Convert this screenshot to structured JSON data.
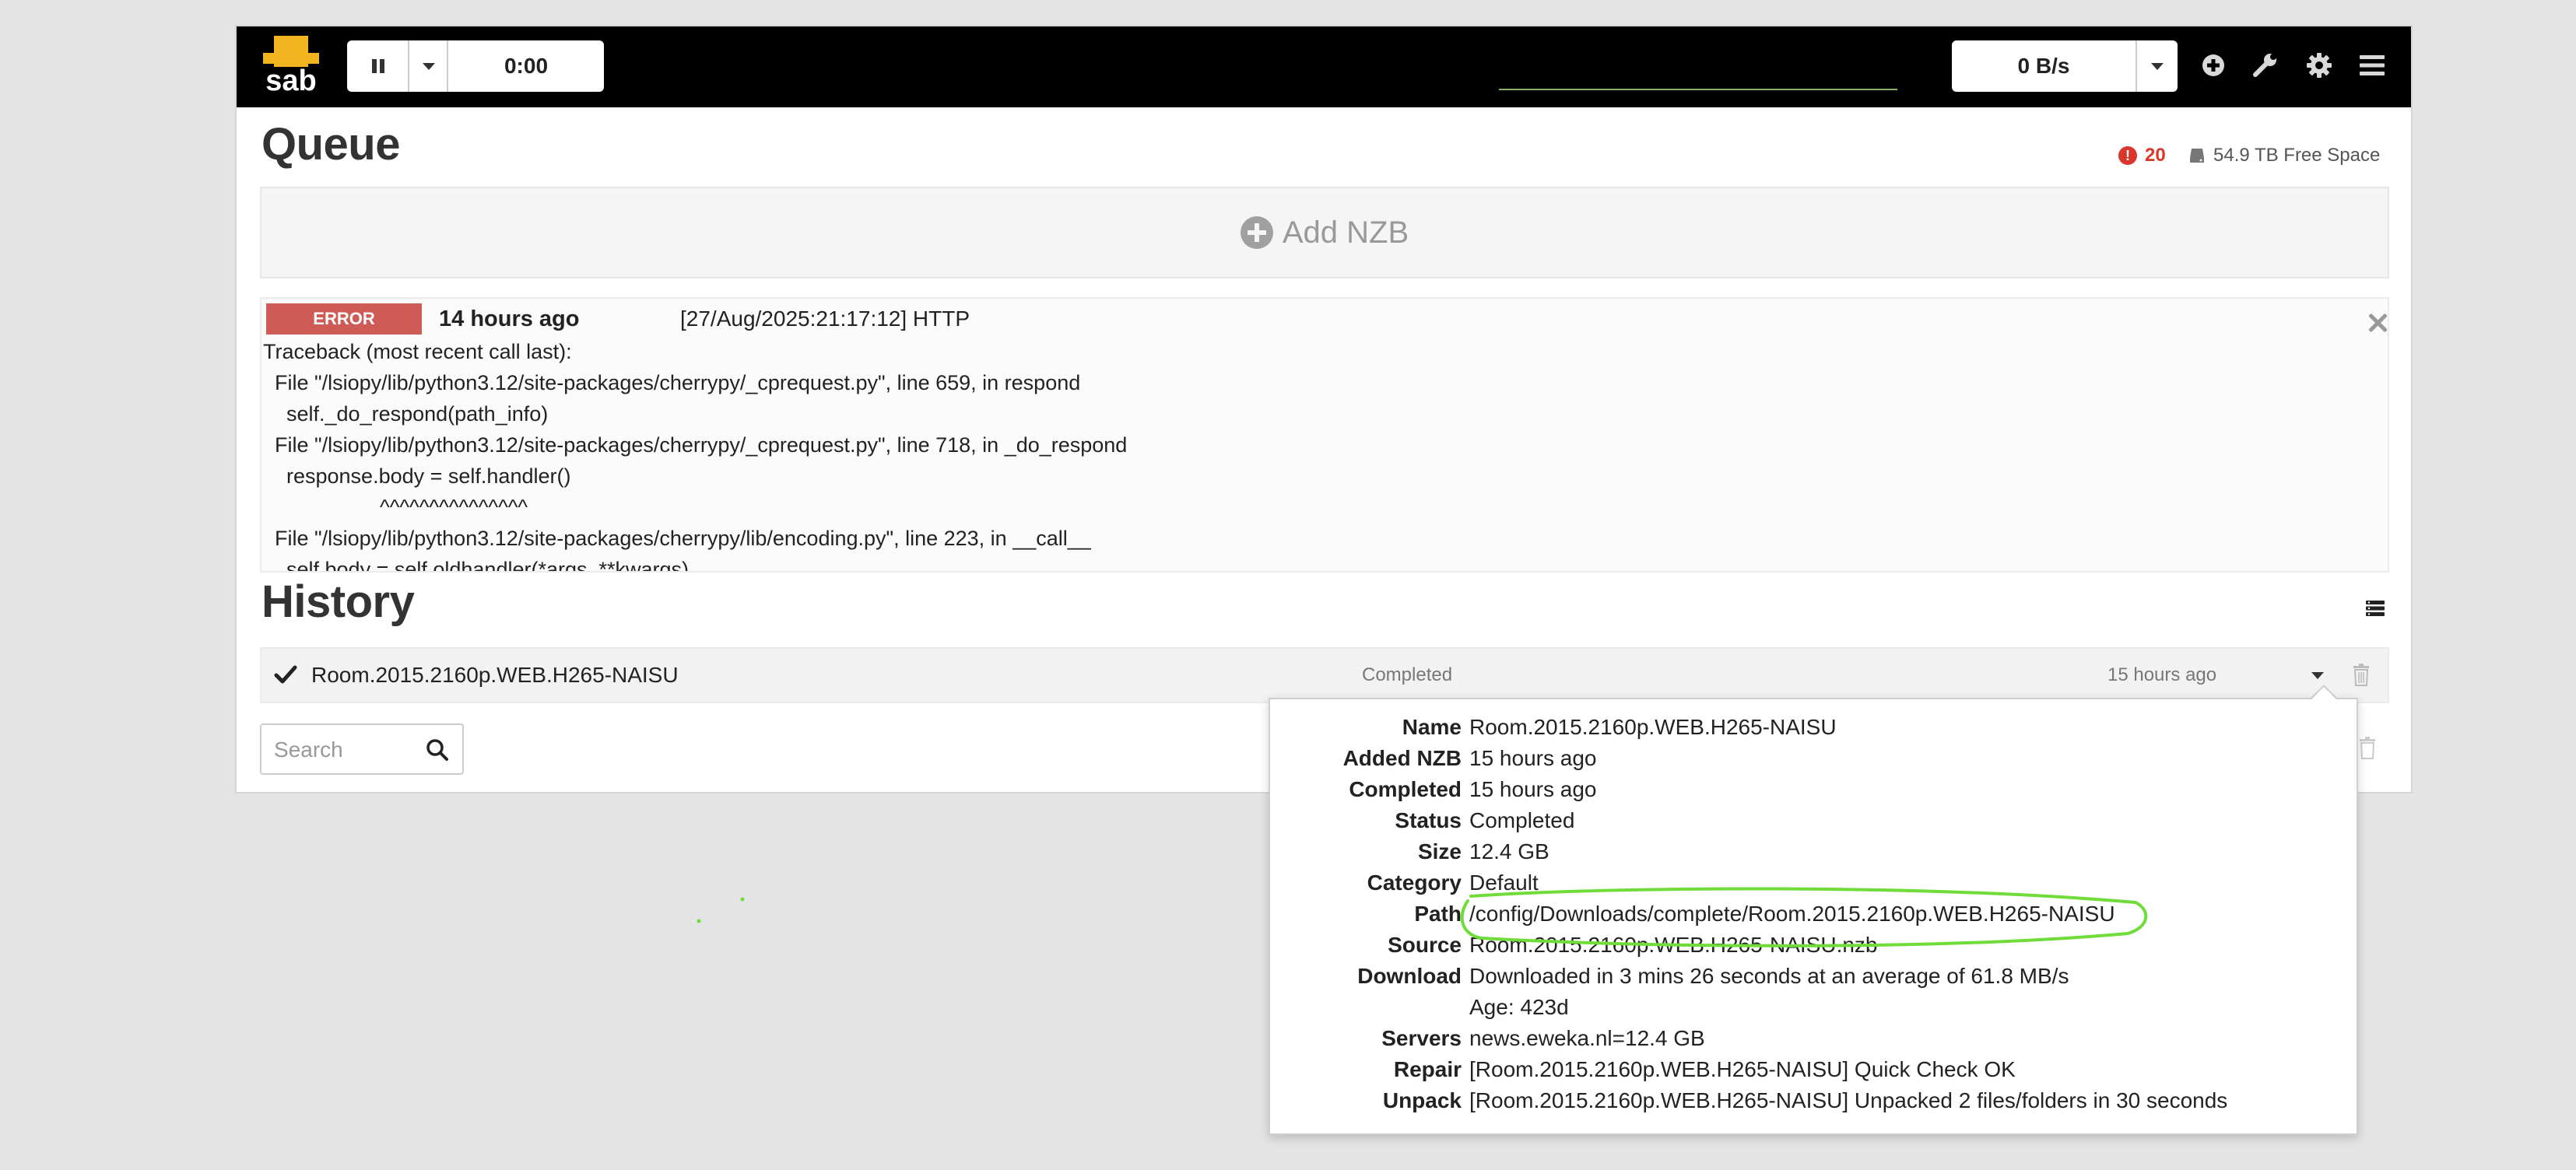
{
  "app": {
    "logo_text": "sab"
  },
  "topbar": {
    "timer": "0:00",
    "speed": "0 B/s",
    "icons": [
      "pause-icon",
      "chevron-down-icon",
      "add-circle-icon",
      "wrench-icon",
      "gear-icon",
      "hamburger-menu-icon"
    ]
  },
  "queue": {
    "title": "Queue",
    "warning_count": "20",
    "free_space": "54.9 TB Free Space",
    "add_nzb_label": "Add NZB",
    "error": {
      "badge": "ERROR",
      "age": "14 hours ago",
      "header": "[27/Aug/2025:21:17:12] HTTP",
      "traceback": "Traceback (most recent call last):\n  File \"/lsiopy/lib/python3.12/site-packages/cherrypy/_cprequest.py\", line 659, in respond\n    self._do_respond(path_info)\n  File \"/lsiopy/lib/python3.12/site-packages/cherrypy/_cprequest.py\", line 718, in _do_respond\n    response.body = self.handler()\n                    ^^^^^^^^^^^^^^^\n  File \"/lsiopy/lib/python3.12/site-packages/cherrypy/lib/encoding.py\", line 223, in __call__\n    self.body = self.oldhandler(*args, **kwargs)"
    }
  },
  "history": {
    "title": "History",
    "row": {
      "name": "Room.2015.2160p.WEB.H265-NAISU",
      "status": "Completed",
      "time": "15 hours ago"
    },
    "search_placeholder": "Search",
    "details": [
      {
        "label": "Name",
        "value": "Room.2015.2160p.WEB.H265-NAISU"
      },
      {
        "label": "Added NZB",
        "value": "15 hours ago"
      },
      {
        "label": "Completed",
        "value": "15 hours ago"
      },
      {
        "label": "Status",
        "value": "Completed"
      },
      {
        "label": "Size",
        "value": "12.4 GB"
      },
      {
        "label": "Category",
        "value": "Default"
      },
      {
        "label": "Path",
        "value": "/config/Downloads/complete/Room.2015.2160p.WEB.H265-NAISU"
      },
      {
        "label": "Source",
        "value": "Room.2015.2160p.WEB.H265-NAISU.nzb"
      },
      {
        "label": "Download",
        "value": "Downloaded in 3 mins 26 seconds at an average of 61.8 MB/s"
      },
      {
        "label": "",
        "value": "Age: 423d"
      },
      {
        "label": "Servers",
        "value": "news.eweka.nl=12.4 GB"
      },
      {
        "label": "Repair",
        "value": "[Room.2015.2160p.WEB.H265-NAISU] Quick Check OK"
      },
      {
        "label": "Unpack",
        "value": "[Room.2015.2160p.WEB.H265-NAISU] Unpacked 2 files/folders in 30 seconds"
      }
    ]
  },
  "colors": {
    "topbar": "#000000",
    "logo": "#f2b51f",
    "error_badge": "#cf5b56",
    "warning": "#d9372b",
    "annotation": "#6fdc3a"
  }
}
